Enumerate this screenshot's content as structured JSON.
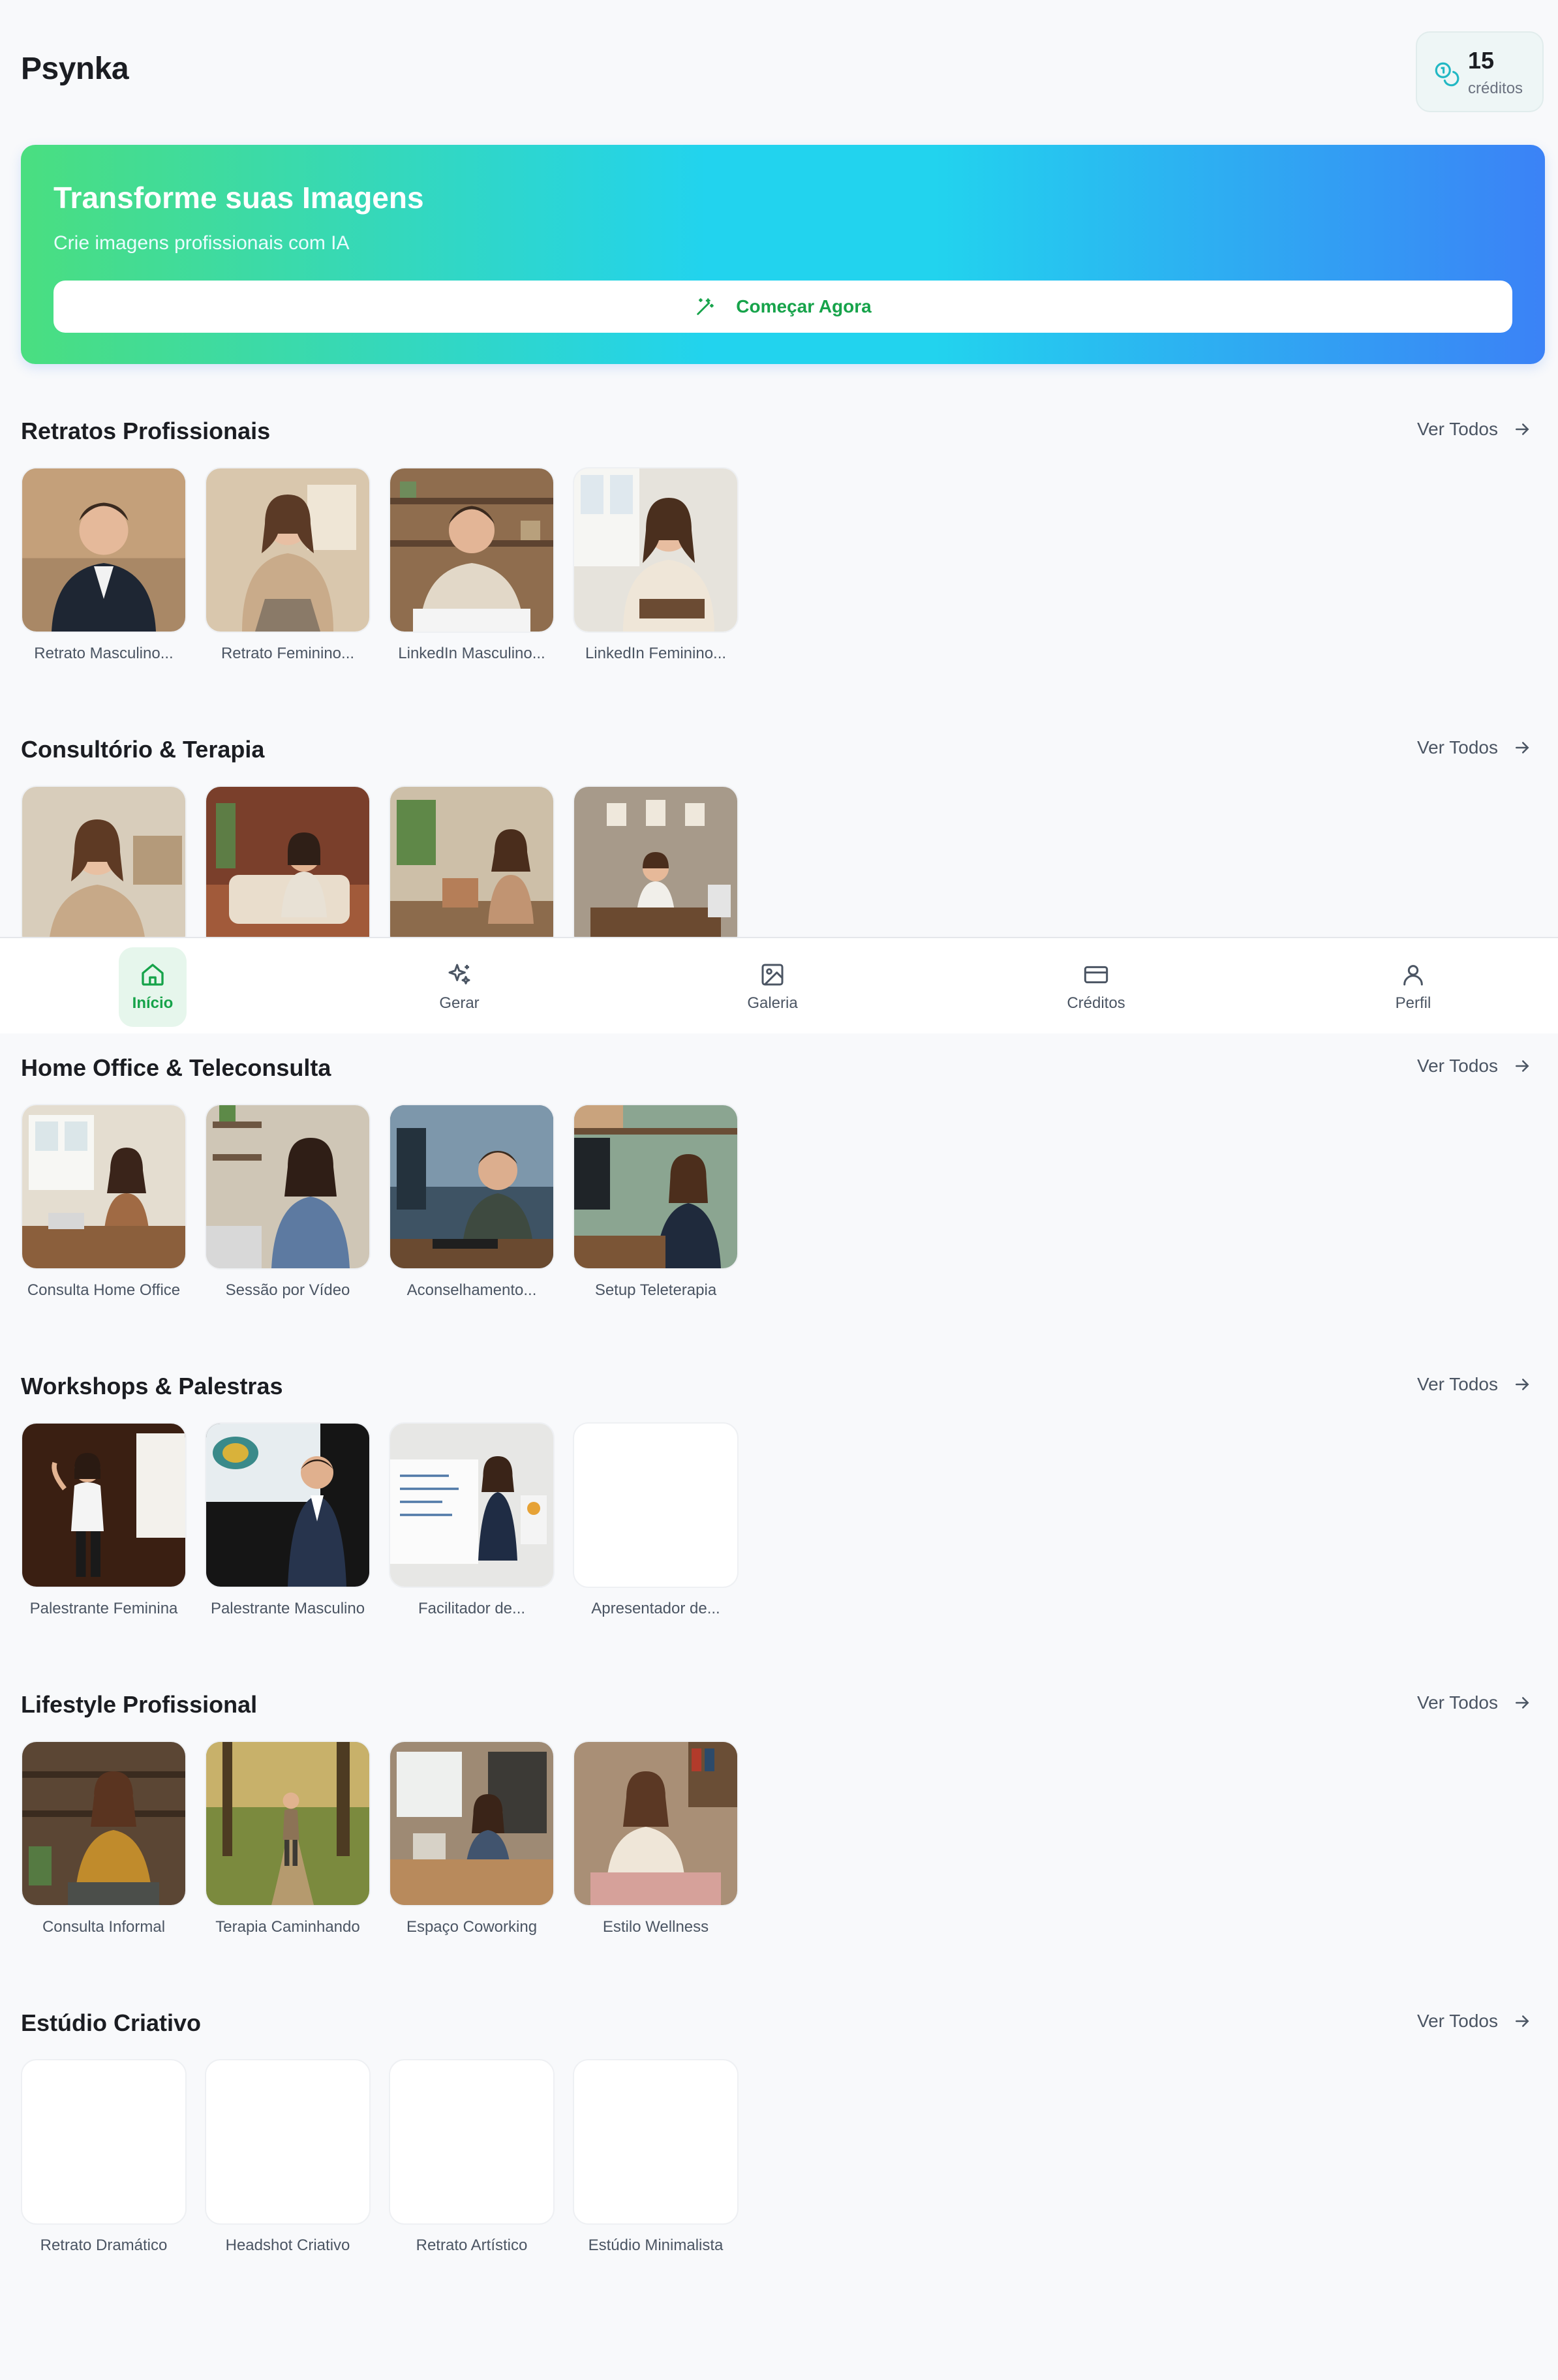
{
  "app": {
    "title": "Psynka"
  },
  "credits": {
    "count": "15",
    "label": "créditos"
  },
  "hero": {
    "title": "Transforme suas Imagens",
    "subtitle": "Crie imagens profissionais com IA",
    "button_label": "Começar Agora"
  },
  "sections": [
    {
      "title": "Retratos Profissionais",
      "see_all": "Ver Todos",
      "items": [
        {
          "label": "Retrato Masculino...",
          "thumb": "photo"
        },
        {
          "label": "Retrato Feminino...",
          "thumb": "photo"
        },
        {
          "label": "LinkedIn Masculino...",
          "thumb": "photo"
        },
        {
          "label": "LinkedIn Feminino...",
          "thumb": "photo"
        }
      ]
    },
    {
      "title": "Consultório & Terapia",
      "see_all": "Ver Todos",
      "items": [
        {
          "label": "",
          "thumb": "photo"
        },
        {
          "label": "",
          "thumb": "photo"
        },
        {
          "label": "",
          "thumb": "photo"
        },
        {
          "label": "",
          "thumb": "photo"
        }
      ]
    },
    {
      "title": "Home Office & Teleconsulta",
      "see_all": "Ver Todos",
      "items": [
        {
          "label": "Consulta Home Office",
          "thumb": "photo"
        },
        {
          "label": "Sessão por Vídeo",
          "thumb": "photo"
        },
        {
          "label": "Aconselhamento...",
          "thumb": "photo"
        },
        {
          "label": "Setup Teleterapia",
          "thumb": "photo"
        }
      ]
    },
    {
      "title": "Workshops & Palestras",
      "see_all": "Ver Todos",
      "items": [
        {
          "label": "Palestrante Feminina",
          "thumb": "photo"
        },
        {
          "label": "Palestrante Masculino",
          "thumb": "photo"
        },
        {
          "label": "Facilitador de...",
          "thumb": "photo"
        },
        {
          "label": "Apresentador de...",
          "thumb": "blank"
        }
      ]
    },
    {
      "title": "Lifestyle Profissional",
      "see_all": "Ver Todos",
      "items": [
        {
          "label": "Consulta Informal",
          "thumb": "photo"
        },
        {
          "label": "Terapia Caminhando",
          "thumb": "photo"
        },
        {
          "label": "Espaço Coworking",
          "thumb": "photo"
        },
        {
          "label": "Estilo Wellness",
          "thumb": "photo"
        }
      ]
    },
    {
      "title": "Estúdio Criativo",
      "see_all": "Ver Todos",
      "items": [
        {
          "label": "Retrato Dramático",
          "thumb": "blank"
        },
        {
          "label": "Headshot Criativo",
          "thumb": "blank"
        },
        {
          "label": "Retrato Artístico",
          "thumb": "blank"
        },
        {
          "label": "Estúdio Minimalista",
          "thumb": "blank"
        }
      ]
    }
  ],
  "nav": [
    {
      "label": "Início",
      "icon": "home-icon",
      "active": true
    },
    {
      "label": "Gerar",
      "icon": "sparkles-icon",
      "active": false
    },
    {
      "label": "Galeria",
      "icon": "image-icon",
      "active": false
    },
    {
      "label": "Créditos",
      "icon": "credit-card-icon",
      "active": false
    },
    {
      "label": "Perfil",
      "icon": "user-icon",
      "active": false
    }
  ],
  "colors": {
    "brand_green": "#16a34a",
    "hero_gradient": [
      "#4ade80",
      "#22d3ee",
      "#3b82f6"
    ],
    "background": "#f8f9fb"
  }
}
